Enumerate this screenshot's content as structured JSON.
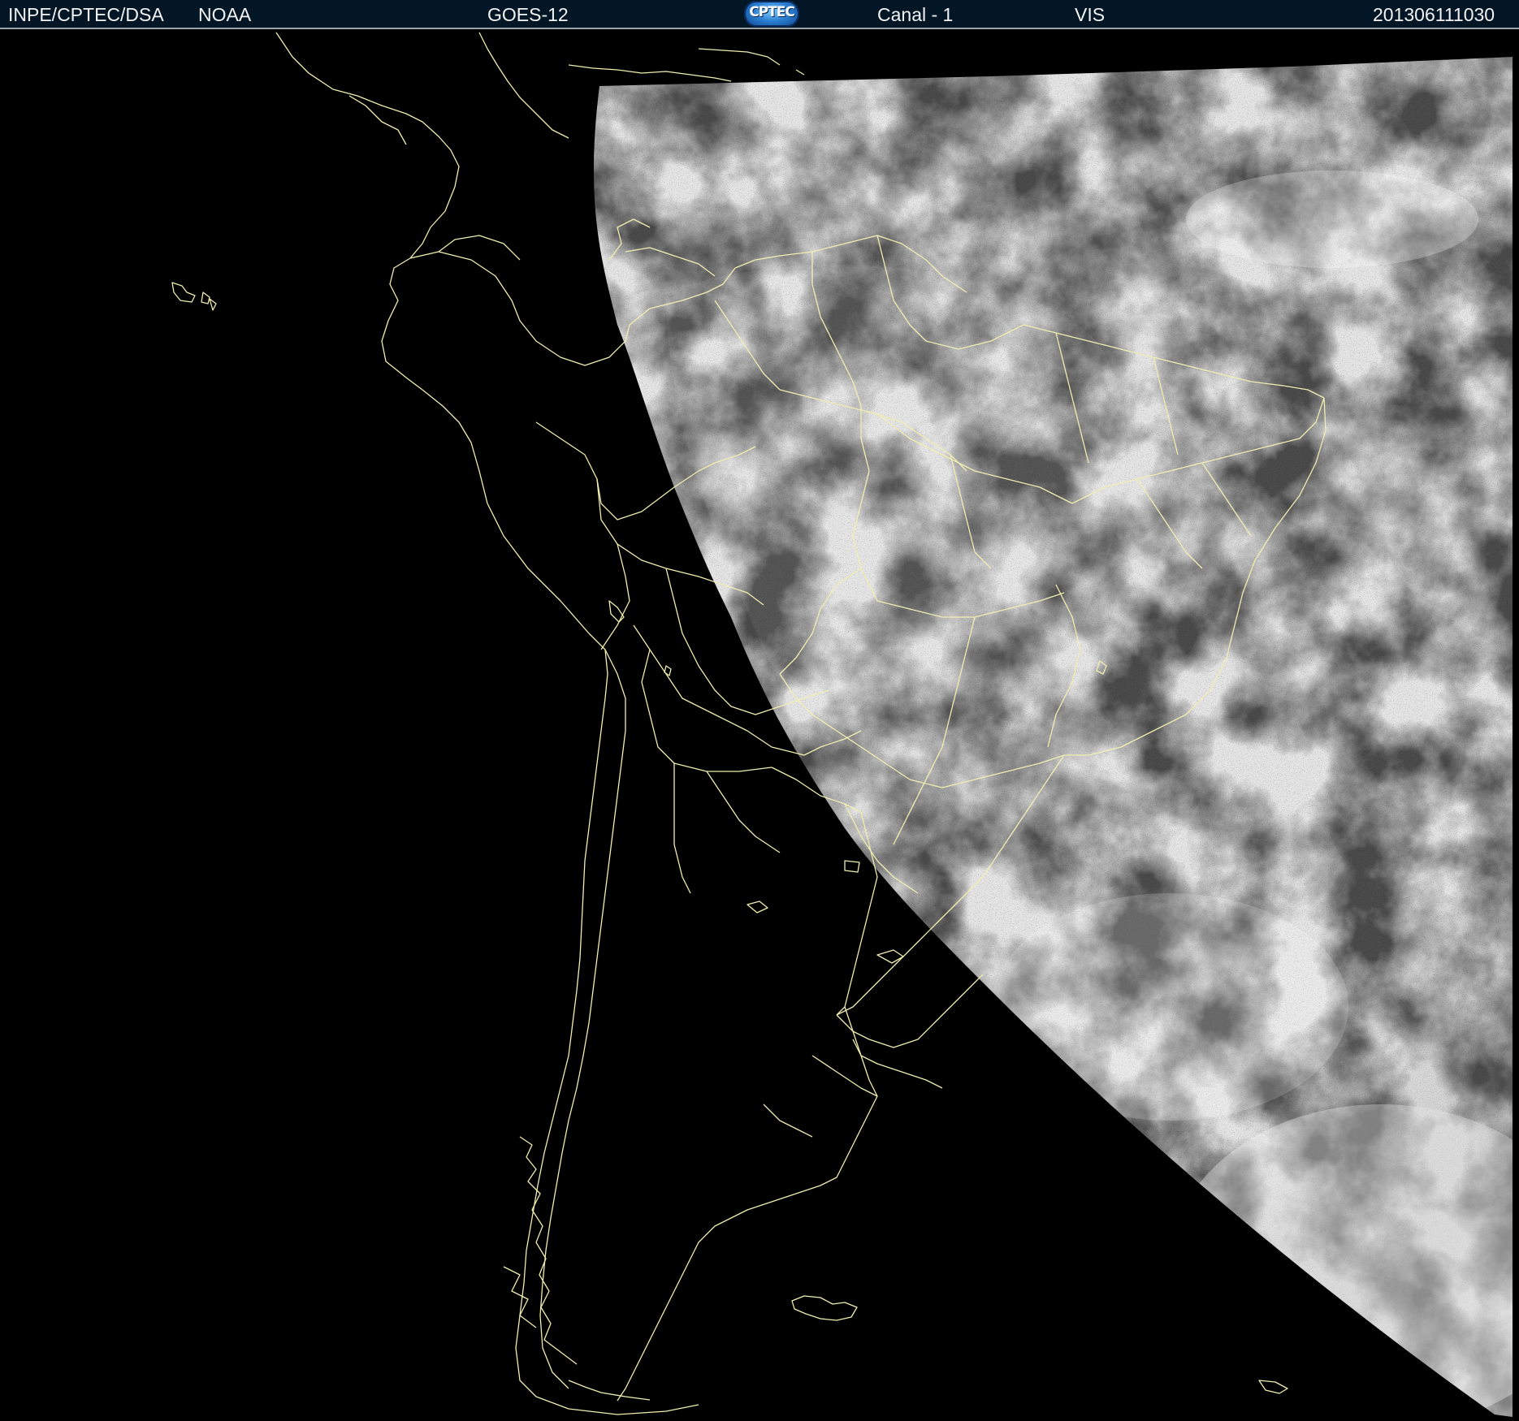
{
  "header": {
    "org": "INPE/CPTEC/DSA",
    "agency": "NOAA",
    "satellite": "GOES-12",
    "logo_text": "CPTEC",
    "channel": "Canal - 1",
    "band": "VIS",
    "timestamp": "201306111030"
  },
  "colors": {
    "header_bg": "#031626",
    "boundary_lines": "#f0eeb0",
    "space": "#000000"
  }
}
